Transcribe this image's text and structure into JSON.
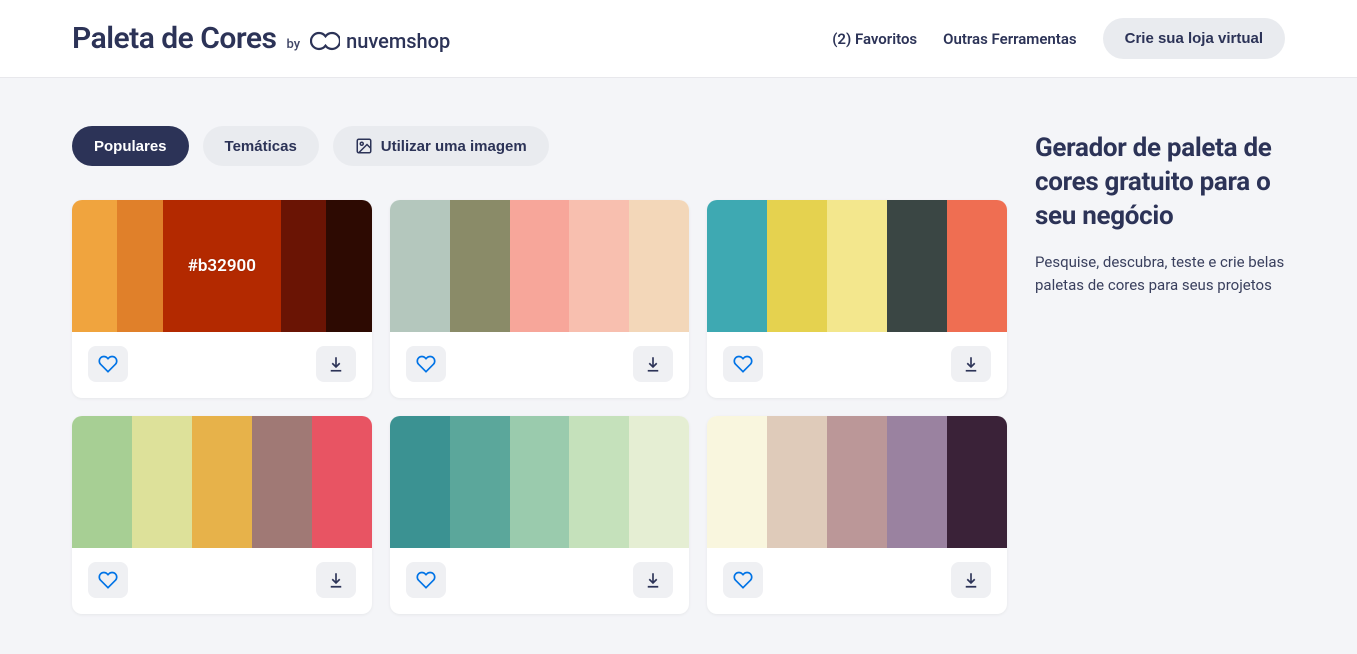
{
  "header": {
    "title": "Paleta de Cores",
    "by": "by",
    "brand": "nuvemshop",
    "nav": {
      "favorites": "(2) Favoritos",
      "tools": "Outras Ferramentas",
      "cta": "Crie sua loja virtual"
    }
  },
  "tabs": {
    "popular": "Populares",
    "thematic": "Temáticas",
    "image": "Utilizar uma imagem"
  },
  "sidebar": {
    "heading": "Gerador de paleta de cores gratuito para o seu negócio",
    "subtext": "Pesquise, descubra, teste e crie belas paletas de cores para seus projetos"
  },
  "hovered": {
    "palette": 0,
    "swatch": 2,
    "label": "#b32900"
  },
  "palettes": [
    {
      "colors": [
        "#f0a43e",
        "#e0802a",
        "#b32900",
        "#6a1404",
        "#2d0a02"
      ]
    },
    {
      "colors": [
        "#b4c7bd",
        "#8a8b68",
        "#f7a69a",
        "#f8bfaf",
        "#f3d7b9"
      ]
    },
    {
      "colors": [
        "#3ea9b2",
        "#e5d24f",
        "#f3e78d",
        "#3a4644",
        "#ef6e52"
      ]
    },
    {
      "colors": [
        "#a7cf94",
        "#dde19a",
        "#e7b24a",
        "#a07975",
        "#e85463"
      ]
    },
    {
      "colors": [
        "#3b9292",
        "#5ba79b",
        "#9acbad",
        "#c5e1bb",
        "#e5eed3"
      ]
    },
    {
      "colors": [
        "#f9f6de",
        "#dfcbba",
        "#bb9798",
        "#9a82a0",
        "#3a2238"
      ]
    }
  ]
}
